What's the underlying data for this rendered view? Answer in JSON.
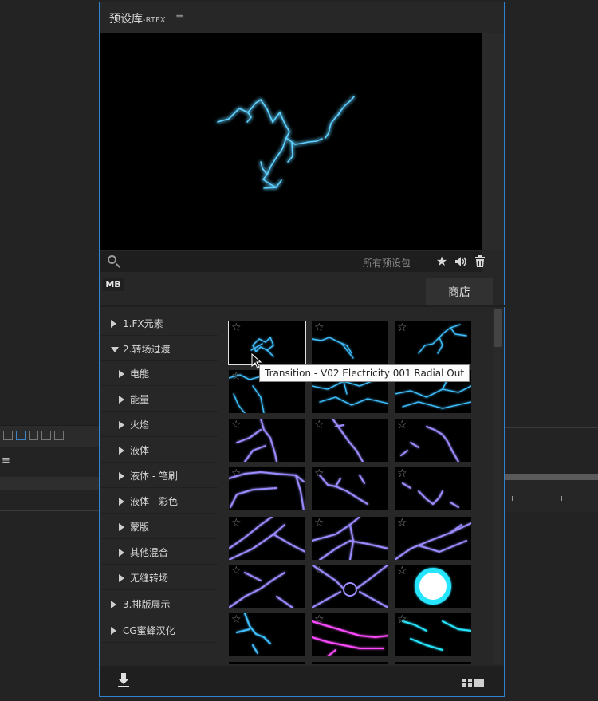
{
  "panel": {
    "title": "预设库",
    "title_suffix": "-RTFX",
    "menu_glyph": "≡"
  },
  "search": {
    "value": "",
    "placeholder": "",
    "scope": "所有预设包"
  },
  "toolbar_icons": [
    "star-icon",
    "volume-icon",
    "trash-icon"
  ],
  "section_label": "MB",
  "store_button": "商店",
  "categories": [
    {
      "label": "1.FX元素",
      "level": 0,
      "expanded": false
    },
    {
      "label": "2.转场过渡",
      "level": 0,
      "expanded": true
    },
    {
      "label": "电能",
      "level": 1,
      "expanded": false
    },
    {
      "label": "能量",
      "level": 1,
      "expanded": false
    },
    {
      "label": "火焰",
      "level": 1,
      "expanded": false
    },
    {
      "label": "液体",
      "level": 1,
      "expanded": false
    },
    {
      "label": "液体 - 笔刷",
      "level": 1,
      "expanded": false
    },
    {
      "label": "液体 - 彩色",
      "level": 1,
      "expanded": false
    },
    {
      "label": "蒙版",
      "level": 1,
      "expanded": false
    },
    {
      "label": "其他混合",
      "level": 1,
      "expanded": false
    },
    {
      "label": "无缝转场",
      "level": 1,
      "expanded": false
    },
    {
      "label": "3.排版展示",
      "level": 0,
      "expanded": false
    },
    {
      "label": "CG蜜蜂汉化",
      "level": 0,
      "expanded": false
    }
  ],
  "tooltip": "Transition - V02 Electricity 001 Radial Out",
  "background_menu_glyph": "≡",
  "colors": {
    "accent_border": "#2f83d1",
    "electric_blue": "#3fc0ff",
    "purple": "#9a8cff",
    "cyan": "#27e6ff",
    "magenta": "#ff4cff"
  }
}
